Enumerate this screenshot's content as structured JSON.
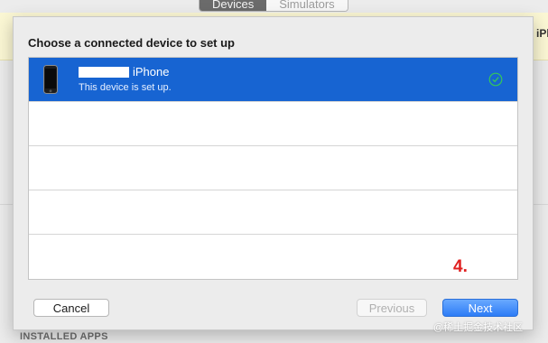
{
  "background": {
    "segmented_control": {
      "items": [
        "Devices",
        "Simulators"
      ],
      "selected": "Devices"
    },
    "banner_right_text": "iPh",
    "installed_apps_label": "INSTALLED APPS"
  },
  "dialog": {
    "title": "Choose a connected device to set up",
    "devices": [
      {
        "name": "iPhone",
        "status": "This device is set up.",
        "icon": "iphone-icon",
        "status_icon": "checkmark-circle-icon",
        "selected": true
      }
    ],
    "empty_row_count": 4,
    "step_annotation": "4.",
    "buttons": {
      "cancel": "Cancel",
      "previous": "Previous",
      "next": "Next"
    }
  },
  "watermark": "@稀土掘金技术社区",
  "colors": {
    "selection": "#1764d2",
    "annotation": "#e02020",
    "primary_button": "#2d7cf6"
  }
}
